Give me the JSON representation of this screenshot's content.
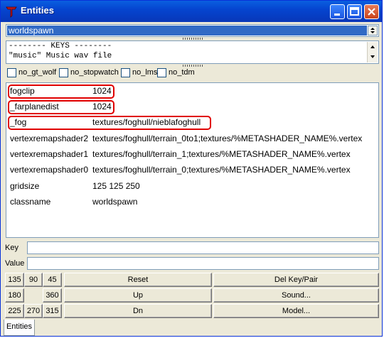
{
  "window": {
    "title": "Entities"
  },
  "entity_class": "worldspawn",
  "keys_memo": [
    "-------- KEYS --------",
    "\"music\" Music wav file"
  ],
  "spawnflags": [
    "no_gt_wolf",
    "no_stopwatch",
    "no_lms",
    "no_tdm"
  ],
  "properties": [
    {
      "key": "fogclip",
      "value": "1024"
    },
    {
      "key": "_farplanedist",
      "value": "1024"
    },
    {
      "key": "_fog",
      "value": "textures/foghull/nieblafoghull"
    },
    {
      "key": "vertexremapshader2",
      "value": "textures/foghull/terrain_0to1;textures/%METASHADER_NAME%.vertex"
    },
    {
      "key": "vertexremapshader1",
      "value": "textures/foghull/terrain_1;textures/%METASHADER_NAME%.vertex"
    },
    {
      "key": "vertexremapshader0",
      "value": "textures/foghull/terrain_0;textures/%METASHADER_NAME%.vertex"
    },
    {
      "key": "gridsize",
      "value": "125 125 250"
    },
    {
      "key": "classname",
      "value": "worldspawn"
    }
  ],
  "fields": {
    "key_label": "Key",
    "value_label": "Value",
    "key_value": "",
    "value_value": ""
  },
  "angles": [
    "135",
    "90",
    "45",
    "180",
    "360",
    "225",
    "270",
    "315"
  ],
  "buttons": {
    "reset": "Reset",
    "up": "Up",
    "dn": "Dn",
    "del": "Del Key/Pair",
    "sound": "Sound...",
    "model": "Model..."
  },
  "tabs": [
    "Entities"
  ],
  "colors": {
    "title_bar": "#0545d0",
    "selection": "#316ac5",
    "highlight_ring": "#e00000"
  }
}
